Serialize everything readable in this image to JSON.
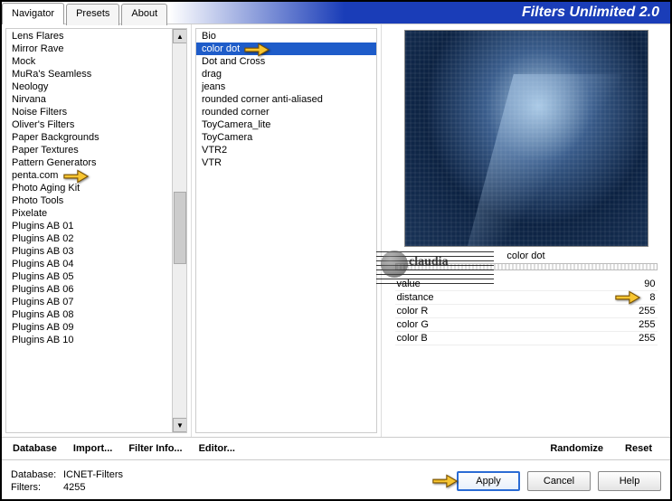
{
  "title": "Filters Unlimited 2.0",
  "tabs": {
    "navigator": "Navigator",
    "presets": "Presets",
    "about": "About",
    "active": "navigator"
  },
  "navigator": {
    "items": [
      "Lens Flares",
      "Mirror Rave",
      "Mock",
      "MuRa's Seamless",
      "Neology",
      "Nirvana",
      "Noise Filters",
      "Oliver's Filters",
      "Paper Backgrounds",
      "Paper Textures",
      "Pattern Generators",
      "penta.com",
      "Photo Aging Kit",
      "Photo Tools",
      "Pixelate",
      "Plugins AB 01",
      "Plugins AB 02",
      "Plugins AB 03",
      "Plugins AB 04",
      "Plugins AB 05",
      "Plugins AB 06",
      "Plugins AB 07",
      "Plugins AB 08",
      "Plugins AB 09",
      "Plugins AB 10"
    ],
    "highlighted": "penta.com"
  },
  "filters": {
    "items": [
      "Bio",
      "color dot",
      "Dot and Cross",
      "drag",
      "jeans",
      "rounded corner anti-aliased",
      "rounded corner",
      "ToyCamera_lite",
      "ToyCamera",
      "VTR2",
      "VTR"
    ],
    "selected": "color dot"
  },
  "preview_label": "color dot",
  "params": [
    {
      "name": "value",
      "value": 90
    },
    {
      "name": "distance",
      "value": 8,
      "highlighted": true
    },
    {
      "name": "color R",
      "value": 255
    },
    {
      "name": "color G",
      "value": 255
    },
    {
      "name": "color B",
      "value": 255
    }
  ],
  "buttons": {
    "database": "Database",
    "import": "Import...",
    "filterinfo": "Filter Info...",
    "editor": "Editor...",
    "randomize": "Randomize",
    "reset": "Reset",
    "apply": "Apply",
    "cancel": "Cancel",
    "help": "Help"
  },
  "status": {
    "db_label": "Database:",
    "db_value": "ICNET-Filters",
    "fl_label": "Filters:",
    "fl_value": "4255"
  },
  "watermark": "claudia"
}
